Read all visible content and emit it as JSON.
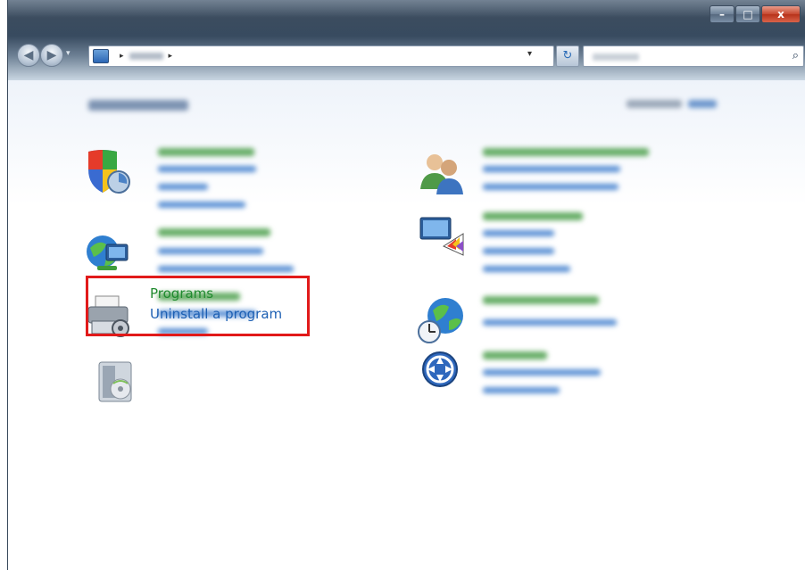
{
  "window": {
    "minimize_label": "–",
    "maximize_label": "□",
    "close_label": "x"
  },
  "toolbar": {
    "back_label": "◀",
    "forward_label": "▶",
    "refresh_label": "↻",
    "search_icon": "⌕"
  },
  "programs": {
    "title": "Programs",
    "link": "Uninstall a program"
  },
  "icons": [
    "security-shield-icon",
    "network-globe-icon",
    "printer-icon",
    "programs-icon",
    "user-accounts-icon",
    "appearance-monitor-icon",
    "clock-globe-icon",
    "ease-of-access-icon"
  ],
  "colors": {
    "category_title": "#1f8a2e",
    "link": "#1c5fb3",
    "highlight": "#e11a1a"
  }
}
